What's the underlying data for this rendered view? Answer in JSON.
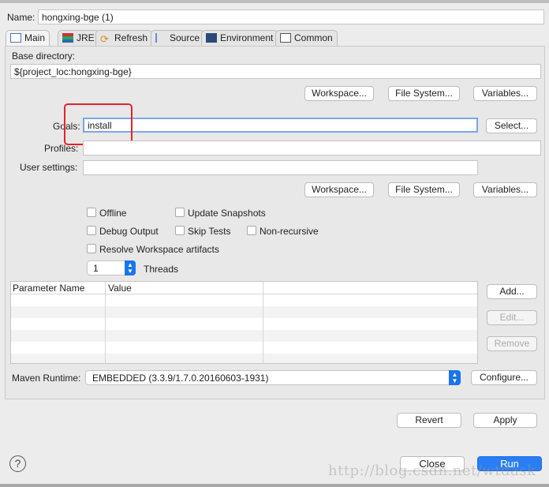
{
  "name_label": "Name:",
  "name_value": "hongxing-bge (1)",
  "tabs": [
    {
      "label": "Main",
      "icon": "main-icon"
    },
    {
      "label": "JRE",
      "icon": "jre-icon"
    },
    {
      "label": "Refresh",
      "icon": "refresh-icon"
    },
    {
      "label": "Source",
      "icon": "source-icon"
    },
    {
      "label": "Environment",
      "icon": "environment-icon"
    },
    {
      "label": "Common",
      "icon": "common-icon"
    }
  ],
  "base_dir_label": "Base directory:",
  "base_dir_value": "${project_loc:hongxing-bge}",
  "buttons": {
    "workspace": "Workspace...",
    "filesystem": "File System...",
    "variables": "Variables...",
    "select": "Select...",
    "add": "Add...",
    "edit": "Edit...",
    "remove": "Remove",
    "configure": "Configure...",
    "revert": "Revert",
    "apply": "Apply",
    "close": "Close",
    "run": "Run"
  },
  "goals_label": "Goals:",
  "goals_value": "install",
  "profiles_label": "Profiles:",
  "profiles_value": "",
  "user_settings_label": "User settings:",
  "user_settings_value": "",
  "checkboxes": {
    "offline": "Offline",
    "update_snapshots": "Update Snapshots",
    "debug_output": "Debug Output",
    "skip_tests": "Skip Tests",
    "non_recursive": "Non-recursive",
    "resolve_workspace": "Resolve Workspace artifacts"
  },
  "threads_value": "1",
  "threads_label": "Threads",
  "table": {
    "columns": [
      "Parameter Name",
      "Value",
      ""
    ]
  },
  "maven_runtime_label": "Maven Runtime:",
  "maven_runtime_value": "EMBEDDED (3.3.9/1.7.0.20160603-1931)",
  "help": "?",
  "watermark": "http://blog.csdn.net/wtdask",
  "colors": {
    "accent": "#1a73f0",
    "highlight": "#e8212a",
    "focus": "#7aa7e8"
  }
}
